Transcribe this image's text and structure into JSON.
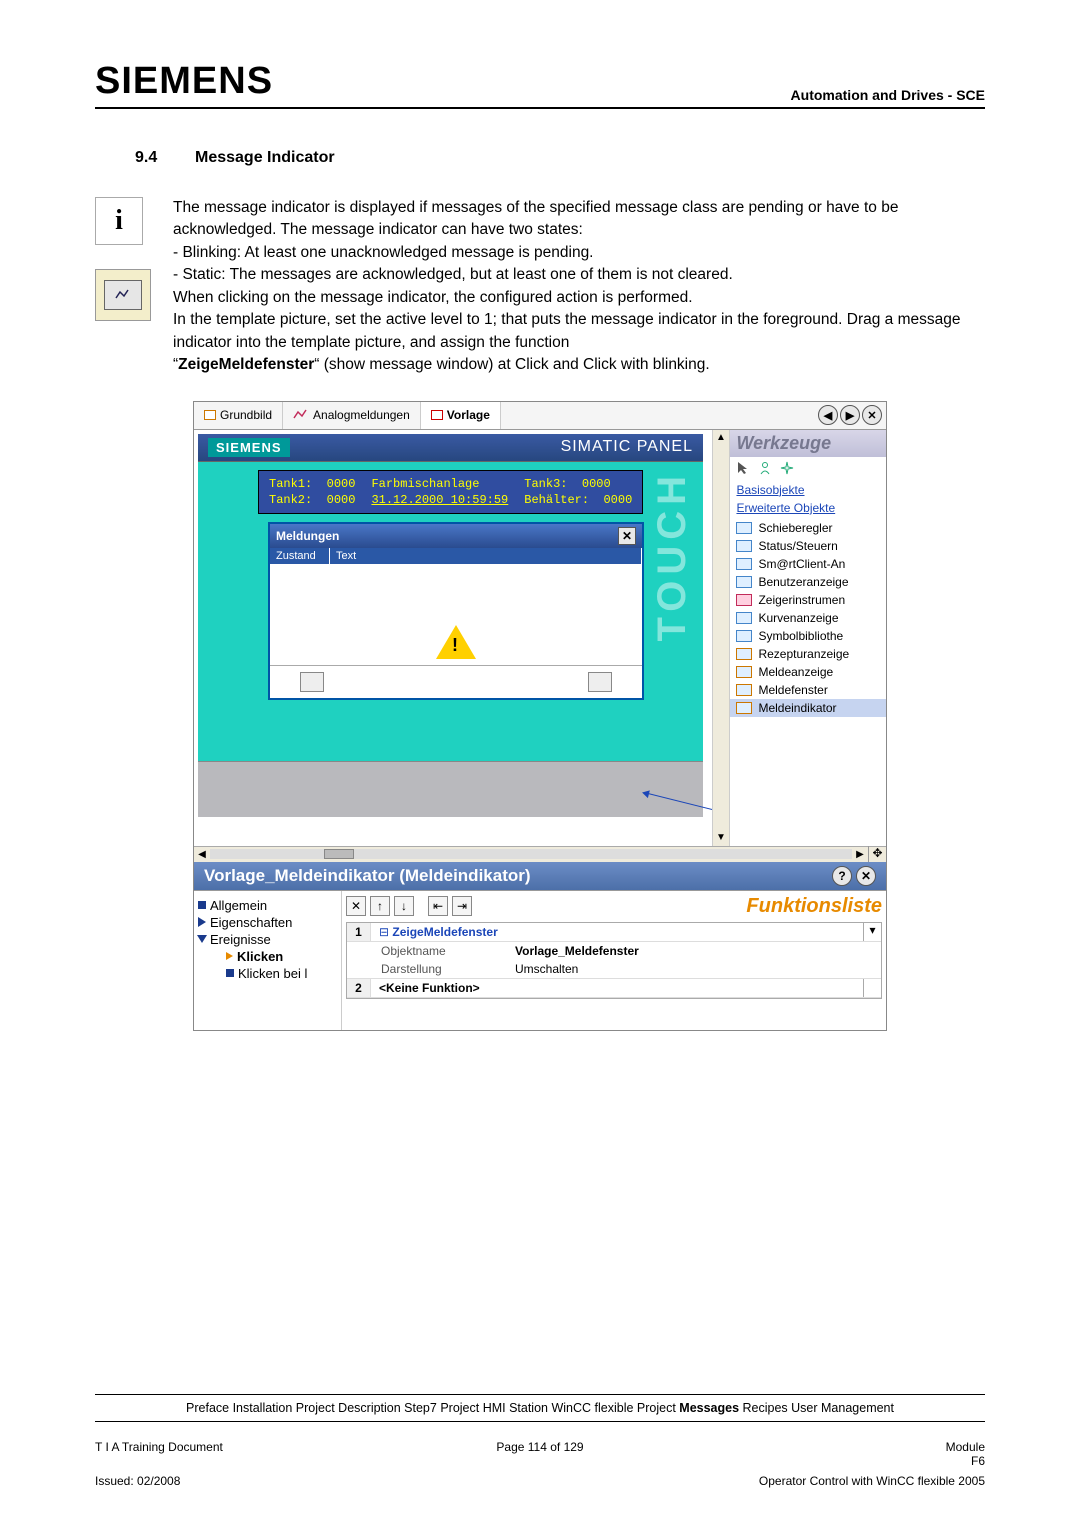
{
  "header": {
    "logo": "SIEMENS",
    "right": "Automation and Drives - SCE"
  },
  "section": {
    "num": "9.4",
    "title": "Message Indicator"
  },
  "para": {
    "p1": "The message indicator is displayed if messages of the specified message class are pending or have to be acknowledged.  The message indicator can have two states:",
    "b1": "- Blinking: At least one unacknowledged message is pending.",
    "b2": "- Static: The messages are acknowledged, but at least one of them is not cleared.",
    "p2": "When clicking on the message indicator, the configured action is performed.",
    "p3": "In the template picture, set the active level to 1; that puts the message indicator in the foreground. Drag a message indicator into the template picture, and assign the function",
    "q1": "“",
    "fn": "ZeigeMeldefenster",
    "q2": "“ (show message window) at Click and Click with blinking."
  },
  "shot": {
    "tabs": {
      "t1": "Grundbild",
      "t2": "Analogmeldungen",
      "t3": "Vorlage"
    },
    "panel": {
      "brand": "SIEMENS",
      "product": "SIMATIC PANEL",
      "touch": "TOUCH"
    },
    "data": {
      "tank1": "Tank1:",
      "v1": "0000",
      "tank2": "Tank2:",
      "v2": "0000",
      "mix": "Farbmischanlage",
      "date": "31.12.2000 10:59:59",
      "tank3": "Tank3:",
      "v3": "0000",
      "beh": "Behälter:",
      "v4": "0000"
    },
    "msg": {
      "title": "Meldungen",
      "c1": "Zustand",
      "c2": "Text"
    },
    "tools": {
      "title": "Werkzeuge",
      "l1": "Basisobjekte",
      "l2": "Erweiterte Objekte",
      "items": [
        "Schieberegler",
        "Status/Steuern",
        "Sm@rtClient-An",
        "Benutzeranzeige",
        "Zeigerinstrumen",
        "Kurvenanzeige",
        "Symbolbibliothe",
        "Rezepturanzeige",
        "Meldeanzeige",
        "Meldefenster",
        "Meldeindikator"
      ]
    }
  },
  "prop": {
    "title": "Vorlage_Meldeindikator (Meldeindikator)",
    "tree": {
      "a": "Allgemein",
      "b": "Eigenschaften",
      "c": "Ereignisse",
      "d": "Klicken",
      "e": "Klicken bei l"
    },
    "func": {
      "title": "Funktionsliste",
      "r1f": "ZeigeMeldefenster",
      "r1a": "Objektname",
      "r1av": "Vorlage_Meldefenster",
      "r1b": "Darstellung",
      "r1bv": "Umschalten",
      "r2": "<Keine Funktion>"
    }
  },
  "crumbs": {
    "pre": "Preface Installation Project Description Step7 Project HMI Station WinCC flexible Project ",
    "bold": "Messages",
    "post": " Recipes User Management"
  },
  "footer": {
    "l1": "T I A  Training Document",
    "c1": "Page 114 of 129",
    "r1": "Module",
    "r1b": "F6",
    "l2": "Issued: 02/2008",
    "r2": "Operator Control with WinCC flexible 2005"
  }
}
